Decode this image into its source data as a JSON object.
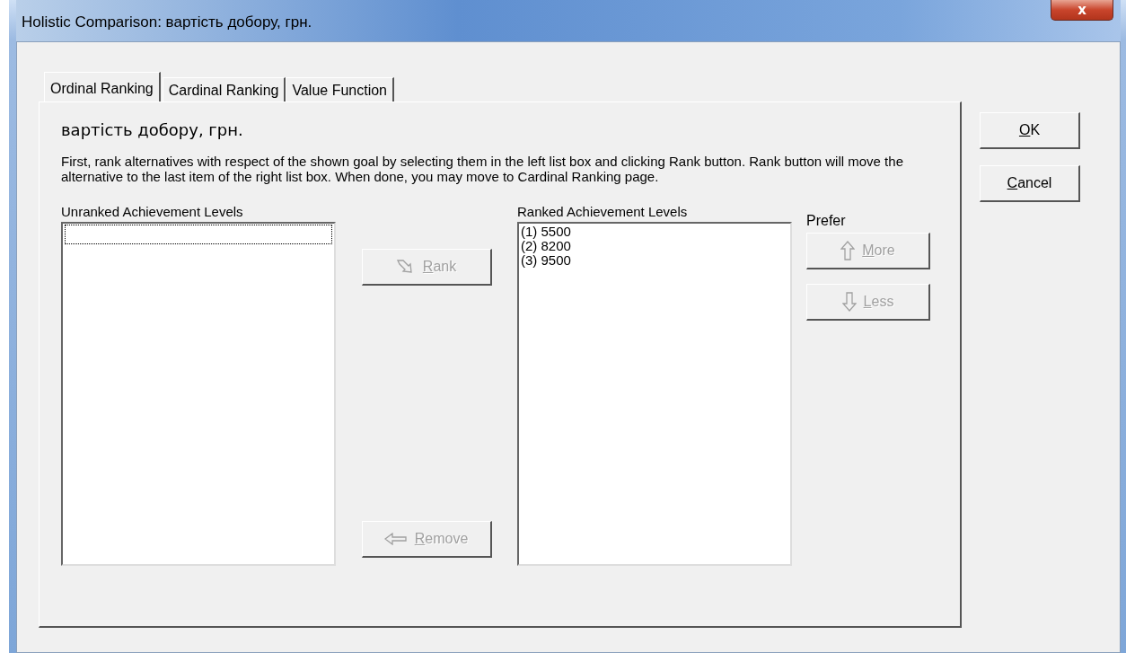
{
  "window": {
    "title": "Holistic Comparison: вартість добору, грн.",
    "close_glyph": "x"
  },
  "tabs": [
    {
      "label": "Ordinal Ranking",
      "selected": true
    },
    {
      "label": "Cardinal Ranking",
      "selected": false
    },
    {
      "label": "Value Function",
      "selected": false
    }
  ],
  "goal": "вартість добору, грн.",
  "instructions": "First, rank alternatives with respect of the shown goal by selecting them in the left list box and clicking Rank button. Rank button will move the alternative to the last item of the right list box. When done, you may move to Cardinal Ranking page.",
  "unranked": {
    "label": "Unranked Achievement Levels",
    "focused": true
  },
  "rank_button": {
    "label": "Rank",
    "disabled": true,
    "underline_first": true
  },
  "remove_button": {
    "label": "Remove",
    "disabled": true,
    "underline_first": true
  },
  "ranked": {
    "label": "Ranked Achievement Levels",
    "items": [
      "(1) 5500",
      "(2) 8200",
      "(3) 9500"
    ]
  },
  "prefer": {
    "label": "Prefer",
    "more": {
      "label": "More",
      "disabled": true,
      "underline_first": true
    },
    "less": {
      "label": "Less",
      "disabled": true,
      "underline_first": true
    }
  },
  "dialog_buttons": [
    {
      "label": "OK",
      "disabled": false,
      "underline_first": true
    },
    {
      "label": "Cancel",
      "disabled": false,
      "underline_first": true
    }
  ]
}
